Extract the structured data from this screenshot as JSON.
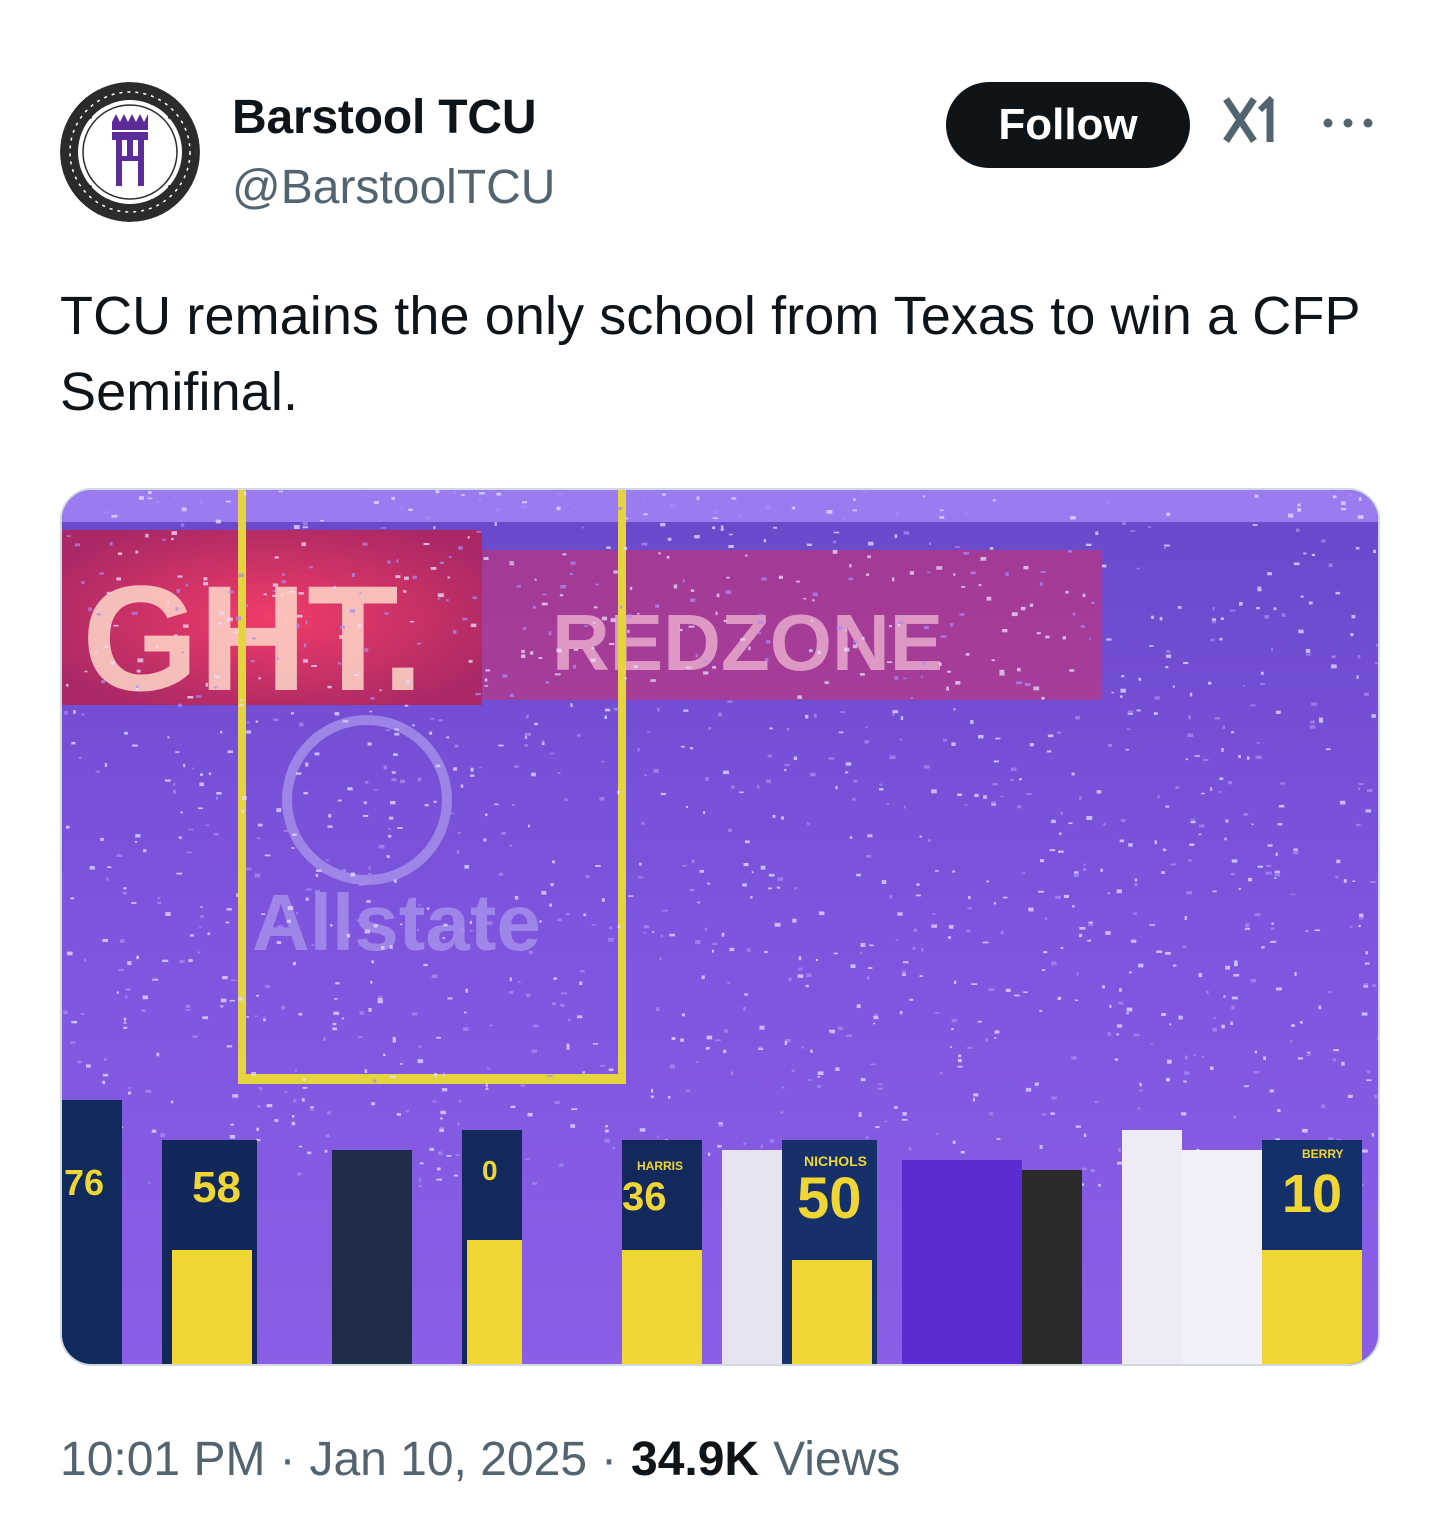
{
  "author": {
    "display_name": "Barstool TCU",
    "handle": "@BarstoolTCU",
    "avatar_icon": "barstool-stool-logo"
  },
  "actions": {
    "follow_label": "Follow",
    "grok_icon": "grok-icon",
    "more_icon": "more-options-icon"
  },
  "tweet": {
    "text": "TCU remains the only school from Texas to win a CFP Semifinal."
  },
  "media": {
    "description_icon": "photo-confetti-celebration",
    "scoreboard_fragment": "GHT.",
    "banner_fragment": "REDZONE",
    "sponsor": "Allstate",
    "jersey_numbers": [
      "76",
      "58",
      "36",
      "50",
      "10",
      "0"
    ],
    "jersey_names": [
      "NICHOLS",
      "HARRIS",
      "BERRY"
    ]
  },
  "footer": {
    "time": "10:01 PM",
    "date": "Jan 10, 2025",
    "separator": "·",
    "views_count": "34.9K",
    "views_label": "Views"
  },
  "colors": {
    "text_primary": "#0f1419",
    "text_secondary": "#536471",
    "follow_bg": "#0f1419",
    "border": "#cfd9de",
    "confetti_purple": "#7b4fe0"
  }
}
